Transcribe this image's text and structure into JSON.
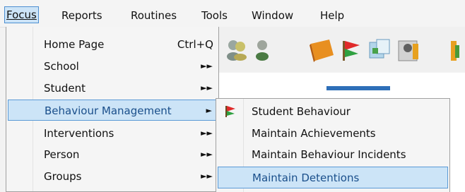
{
  "menubar": {
    "items": [
      {
        "label": "Focus",
        "underline": "F"
      },
      {
        "label": "Reports",
        "underline": "R"
      },
      {
        "label": "Routines",
        "underline": "o"
      },
      {
        "label": "Tools",
        "underline": "T"
      },
      {
        "label": "Window",
        "underline": "W"
      },
      {
        "label": "Help",
        "underline": "H"
      }
    ]
  },
  "focus_menu": {
    "items": [
      {
        "label": "Home Page",
        "shortcut": "Ctrl+Q"
      },
      {
        "label": "School"
      },
      {
        "label": "Student"
      },
      {
        "label": "Behaviour Management"
      },
      {
        "label": "Interventions"
      },
      {
        "label": "Person"
      },
      {
        "label": "Groups"
      }
    ]
  },
  "behaviour_submenu": {
    "items": [
      {
        "label": "Student Behaviour",
        "icon": "red-green-flag-icon"
      },
      {
        "label": "Maintain Achievements"
      },
      {
        "label": "Maintain Behaviour Incidents"
      },
      {
        "label": "Maintain Detentions"
      }
    ]
  },
  "toolbar": {
    "icons": [
      "people-pair-icon",
      "person-icon",
      "book-icon",
      "flag-icon",
      "notes-icon",
      "contact-card-icon",
      "edge-icon"
    ]
  },
  "colors": {
    "highlight_bg": "#cce4f7",
    "highlight_border": "#5a9ad6",
    "menu_bg": "#f5f5f5"
  }
}
